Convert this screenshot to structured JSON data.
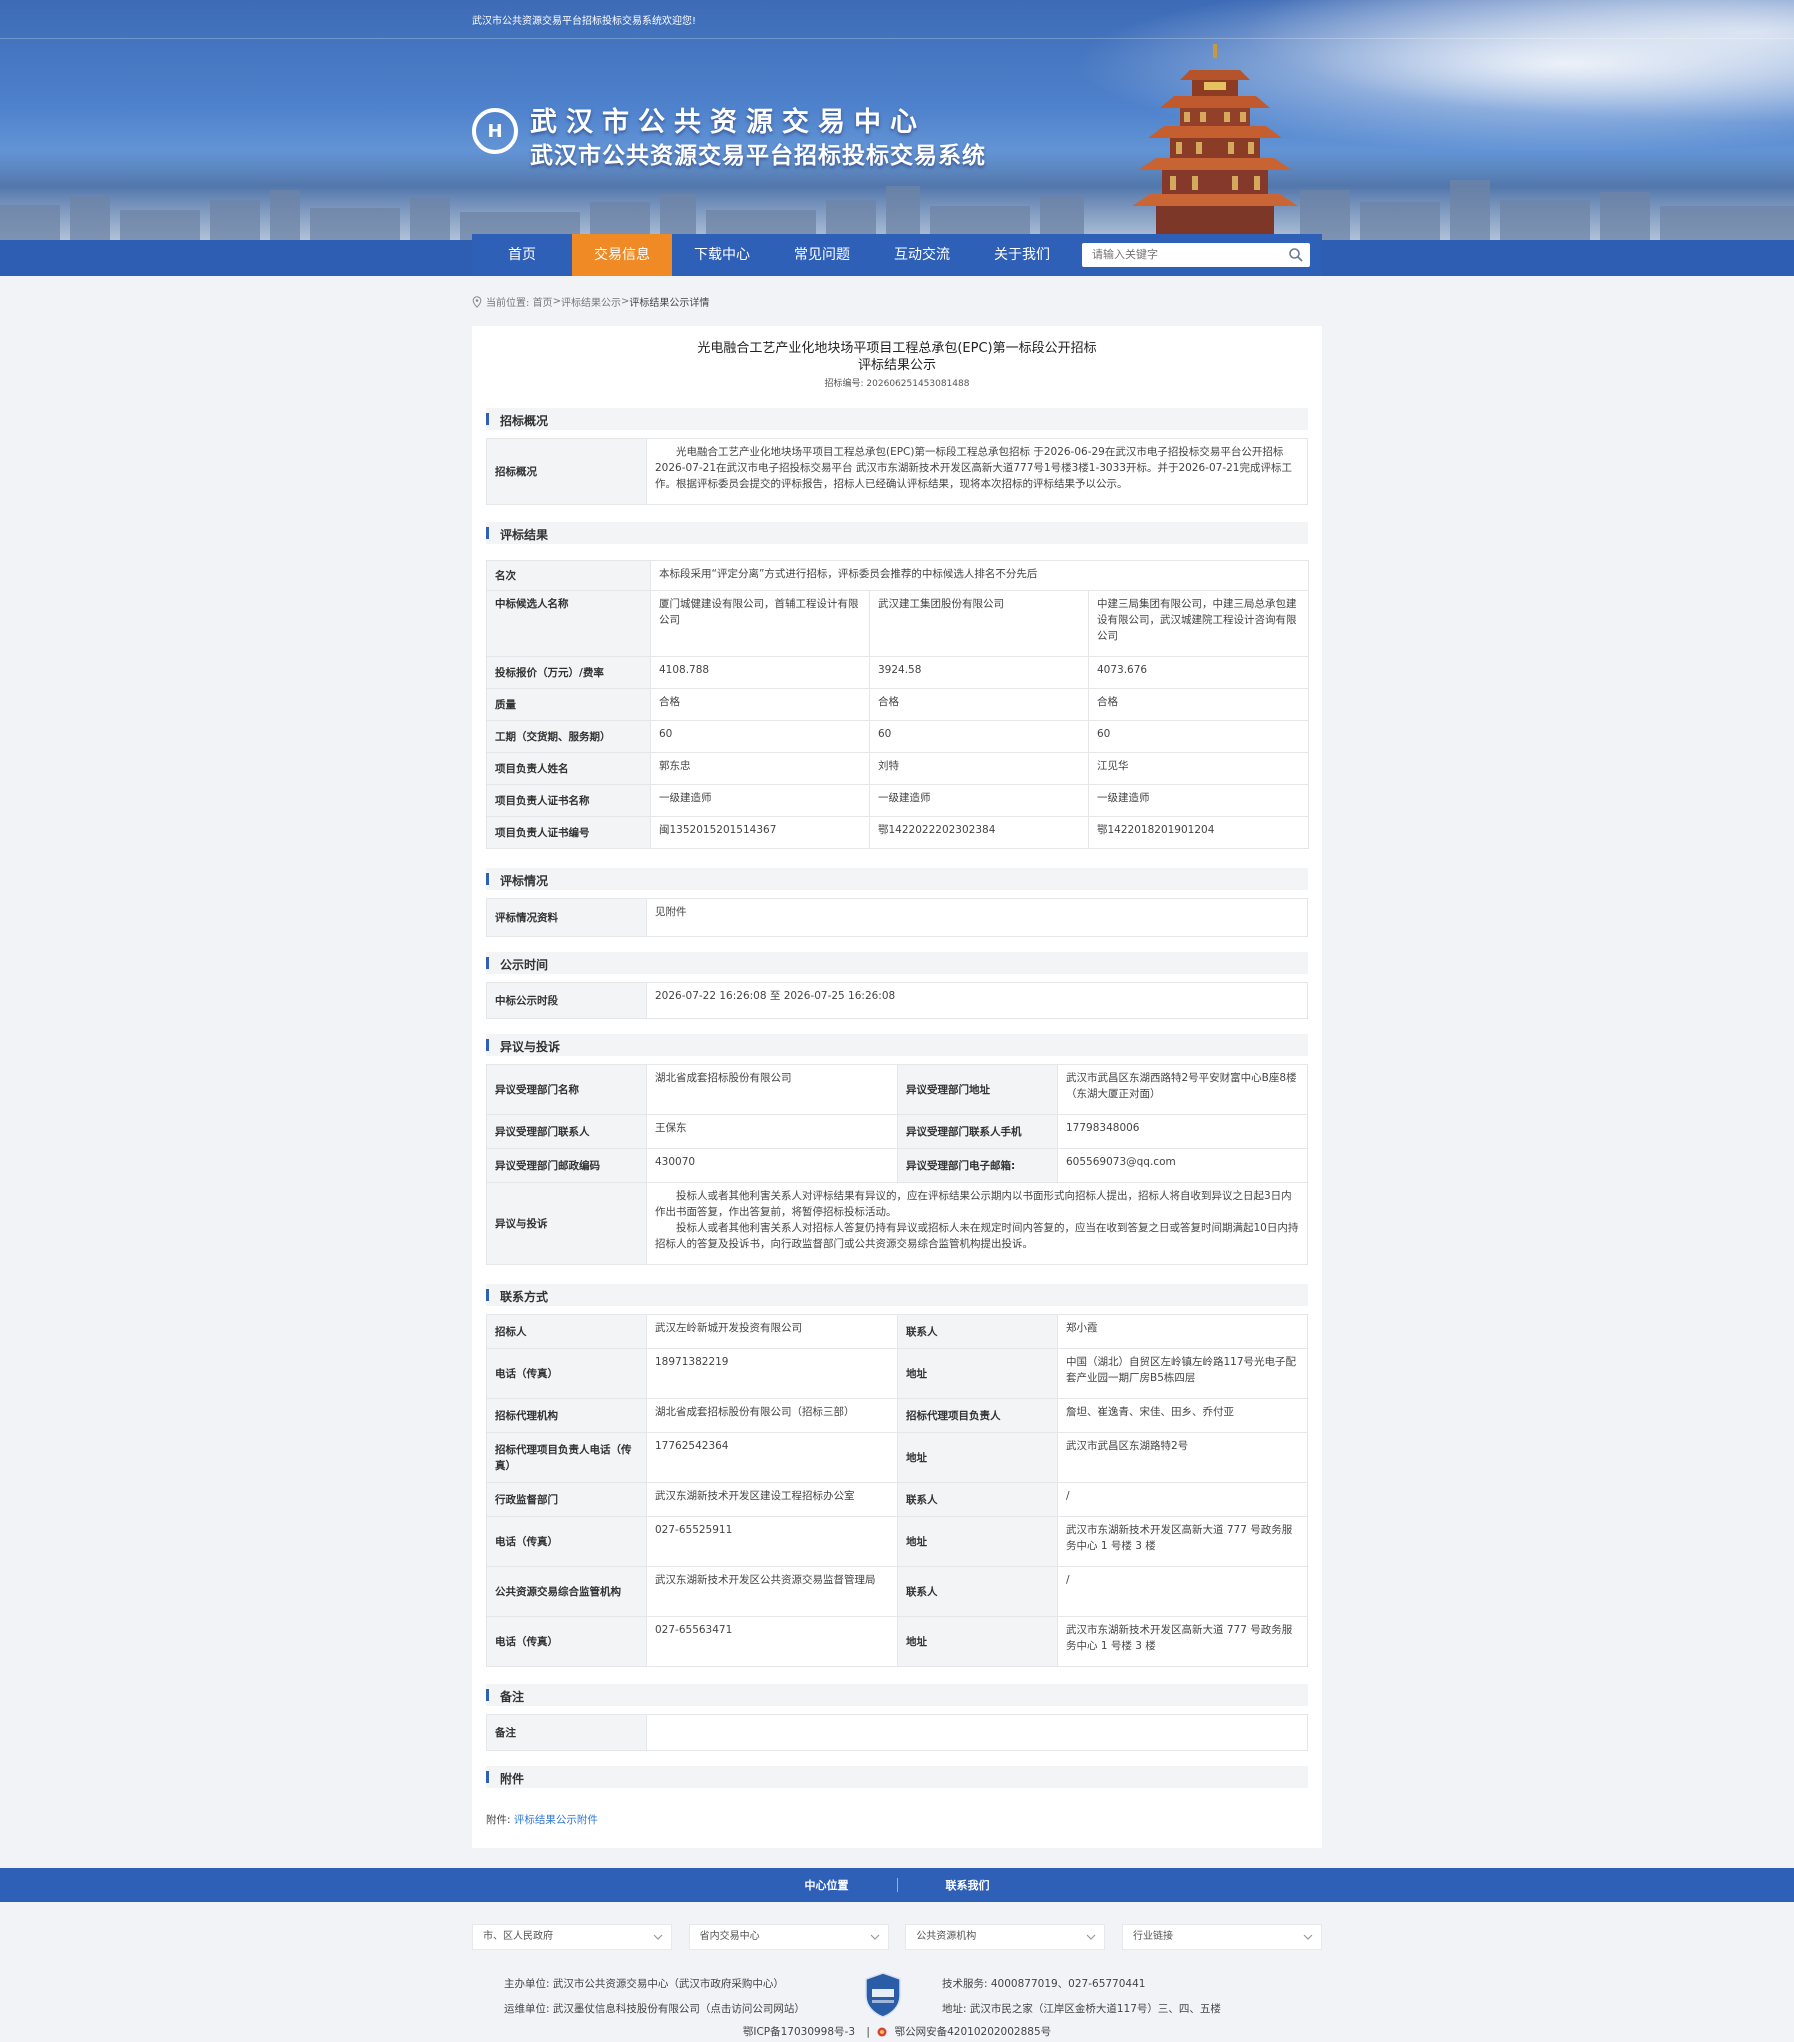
{
  "header": {
    "welcome": "武汉市公共资源交易平台招标投标交易系统欢迎您!",
    "title_main": "武汉市公共资源交易中心",
    "title_sub": "武汉市公共资源交易平台招标投标交易系统",
    "logo_text": "H"
  },
  "nav": {
    "items": [
      "首页",
      "交易信息",
      "下载中心",
      "常见问题",
      "互动交流",
      "关于我们"
    ],
    "active_index": 1,
    "search_placeholder": "请输入关键字"
  },
  "breadcrumb": {
    "prefix": "当前位置:",
    "home": "首页",
    "sep": ">",
    "level1": "评标结果公示",
    "current": "评标结果公示详情"
  },
  "doc": {
    "title_line1": "光电融合工艺产业化地块场平项目工程总承包(EPC)第一标段公开招标",
    "title_line2": "评标结果公示",
    "bid_no": "招标编号: 202606251453081488"
  },
  "sections": {
    "overview": "招标概况",
    "result": "评标结果",
    "situation": "评标情况",
    "period": "公示时间",
    "objection": "异议与投诉",
    "contact": "联系方式",
    "remark": "备注",
    "attachment": "附件"
  },
  "overview": {
    "label": "招标概况",
    "text": "光电融合工艺产业化地块场平项目工程总承包(EPC)第一标段工程总承包招标 于2026-06-29在武汉市电子招投标交易平台公开招标2026-07-21在武汉市电子招投标交易平台 武汉市东湖新技术开发区高新大道777号1号楼3楼1-3033开标。并于2026-07-21完成评标工作。根据评标委员会提交的评标报告，招标人已经确认评标结果，现将本次招标的评标结果予以公示。"
  },
  "result": {
    "rank_label": "名次",
    "rank_text": "本标段采用“评定分离”方式进行招标，评标委员会推荐的中标候选人排名不分先后",
    "rows": [
      {
        "label": "中标候选人名称",
        "values": [
          "厦门城健建设有限公司，首辅工程设计有限公司",
          "武汉建工集团股份有限公司",
          "中建三局集团有限公司，中建三局总承包建设有限公司，武汉城建院工程设计咨询有限公司"
        ]
      },
      {
        "label": "投标报价（万元）/费率",
        "values": [
          "4108.788",
          "3924.58",
          "4073.676"
        ]
      },
      {
        "label": "质量",
        "values": [
          "合格",
          "合格",
          "合格"
        ]
      },
      {
        "label": "工期（交货期、服务期）",
        "values": [
          "60",
          "60",
          "60"
        ]
      },
      {
        "label": "项目负责人姓名",
        "values": [
          "郭东忠",
          "刘特",
          "江见华"
        ]
      },
      {
        "label": "项目负责人证书名称",
        "values": [
          "一级建造师",
          "一级建造师",
          "一级建造师"
        ]
      },
      {
        "label": "项目负责人证书编号",
        "values": [
          "闽1352015201514367",
          "鄂1422022202302384",
          "鄂1422018201901204"
        ]
      }
    ]
  },
  "situation": {
    "label": "评标情况资料",
    "value": "见附件"
  },
  "period": {
    "label": "中标公示时段",
    "value": "2026-07-22 16:26:08 至 2026-07-25 16:26:08"
  },
  "objection": {
    "dept_name_label": "异议受理部门名称",
    "dept_name": "湖北省成套招标股份有限公司",
    "dept_addr_label": "异议受理部门地址",
    "dept_addr": "武汉市武昌区东湖西路特2号平安财富中心B座8楼（东湖大厦正对面）",
    "contact_label": "异议受理部门联系人",
    "contact": "王保东",
    "phone_label": "异议受理部门联系人手机",
    "phone": "17798348006",
    "zip_label": "异议受理部门邮政编码",
    "zip": "430070",
    "email_label": "异议受理部门电子邮箱:",
    "email": "605569073@qq.com",
    "text_label": "异议与投诉",
    "text1": "投标人或者其他利害关系人对评标结果有异议的，应在评标结果公示期内以书面形式向招标人提出，招标人将自收到异议之日起3日内作出书面答复，作出答复前，将暂停招标投标活动。",
    "text2": "投标人或者其他利害关系人对招标人答复仍持有异议或招标人未在规定时间内答复的，应当在收到答复之日或答复时间期满起10日内持招标人的答复及投诉书，向行政监督部门或公共资源交易综合监管机构提出投诉。"
  },
  "contact": {
    "rows": [
      [
        "招标人",
        "武汉左岭新城开发投资有限公司",
        "联系人",
        "郑小霞"
      ],
      [
        "电话（传真）",
        "18971382219",
        "地址",
        "中国（湖北）自贸区左岭镇左岭路117号光电子配套产业园一期厂房B5栋四层"
      ],
      [
        "招标代理机构",
        "湖北省成套招标股份有限公司（招标三部）",
        "招标代理项目负责人",
        "詹坦、崔逸青、宋佳、田乡、乔付亚"
      ],
      [
        "招标代理项目负责人电话（传真）",
        "17762542364",
        "地址",
        "武汉市武昌区东湖路特2号"
      ],
      [
        "行政监督部门",
        "武汉东湖新技术开发区建设工程招标办公室",
        "联系人",
        "/"
      ],
      [
        "电话（传真）",
        "027-65525911",
        "地址",
        "武汉市东湖新技术开发区高新大道 777 号政务服务中心 1 号楼 3 楼"
      ],
      [
        "公共资源交易综合监管机构",
        "武汉东湖新技术开发区公共资源交易监督管理局",
        "联系人",
        "/"
      ],
      [
        "电话（传真）",
        "027-65563471",
        "地址",
        "武汉市东湖新技术开发区高新大道 777 号政务服务中心 1 号楼 3 楼"
      ]
    ]
  },
  "remark": {
    "label": "备注",
    "value": ""
  },
  "attachment": {
    "label": "附件:",
    "link": "评标结果公示附件"
  },
  "footer": {
    "links": [
      "中心位置",
      "联系我们"
    ],
    "selects": [
      "市、区人民政府",
      "省内交易中心",
      "公共资源机构",
      "行业链接"
    ],
    "host": "主办单位: 武汉市公共资源交易中心（武汉市政府采购中心）",
    "operator": "运维单位: 武汉墨仗信息科技股份有限公司（点击访问公司网站）",
    "tech": "技术服务: 4000877019、027-65770441",
    "address": "地址: 武汉市民之家（江岸区金桥大道117号）三、四、五楼",
    "icp": "鄂ICP备17030998号-3",
    "icp_sep": "|",
    "police": "鄂公网安备42010202002885号"
  },
  "colors": {
    "primary": "#2f60b8",
    "accent": "#f08a24",
    "link": "#2f79d6"
  }
}
